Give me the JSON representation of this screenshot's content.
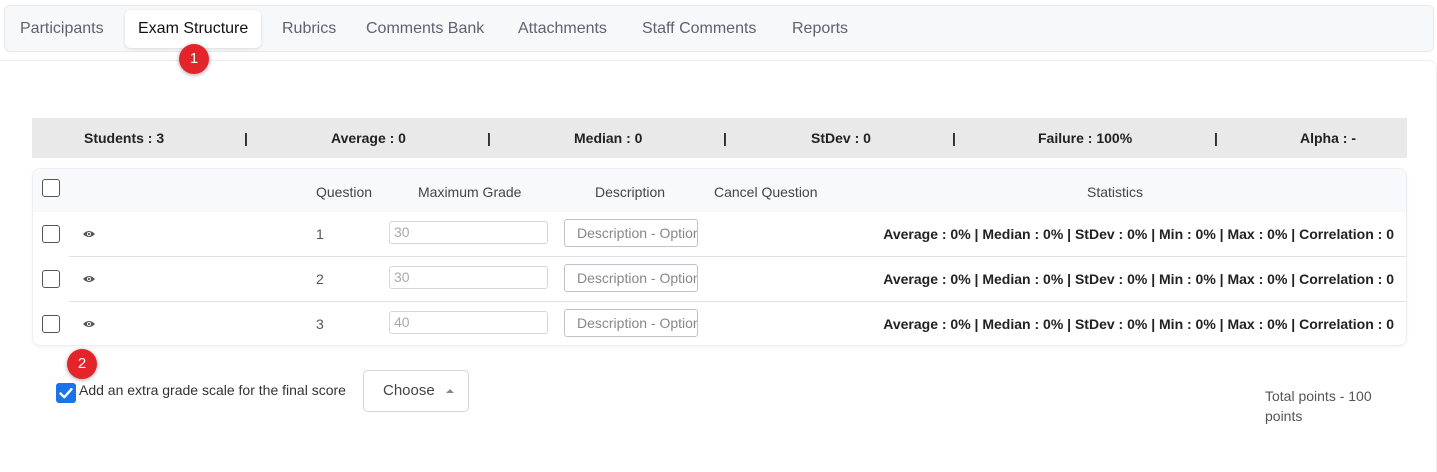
{
  "tabs": [
    {
      "label": "Participants"
    },
    {
      "label": "Exam Structure"
    },
    {
      "label": "Rubrics"
    },
    {
      "label": "Comments Bank"
    },
    {
      "label": "Attachments"
    },
    {
      "label": "Staff Comments"
    },
    {
      "label": "Reports"
    }
  ],
  "badges": {
    "one": "1",
    "two": "2"
  },
  "summary": {
    "students": "Students : 3",
    "average": "Average : 0",
    "median": "Median : 0",
    "stdev": "StDev : 0",
    "failure": "Failure : 100%",
    "alpha": "Alpha : -",
    "separator": "|"
  },
  "table": {
    "headers": {
      "question": "Question",
      "max_grade": "Maximum Grade",
      "description": "Description",
      "cancel": "Cancel Question",
      "statistics": "Statistics"
    },
    "rows": [
      {
        "question": "1",
        "max_grade": "30",
        "description_placeholder": "Description - Optional",
        "stats": "Average : 0%  |  Median : 0%  |  StDev : 0%  |  Min : 0%  |  Max : 0%  |  Correlation : 0"
      },
      {
        "question": "2",
        "max_grade": "30",
        "description_placeholder": "Description - Optional",
        "stats": "Average : 0%  |  Median : 0%  |  StDev : 0%  |  Min : 0%  |  Max : 0%  |  Correlation : 0"
      },
      {
        "question": "3",
        "max_grade": "40",
        "description_placeholder": "Description - Optional",
        "stats": "Average : 0%  |  Median : 0%  |  StDev : 0%  |  Min : 0%  |  Max : 0%  |  Correlation : 0"
      }
    ]
  },
  "footer": {
    "extra_scale_label": "Add an extra grade scale for the final score",
    "extra_scale_checked": true,
    "choose_label": "Choose",
    "total_points": "Total points - 100 points"
  },
  "icons": {
    "view": "eye-icon",
    "dropdown": "caret-up-icon",
    "check": "checkmark-icon"
  },
  "colors": {
    "badge": "#e3242b",
    "checkbox_accent": "#1a73e8",
    "summary_bg": "#e9e9e9"
  }
}
